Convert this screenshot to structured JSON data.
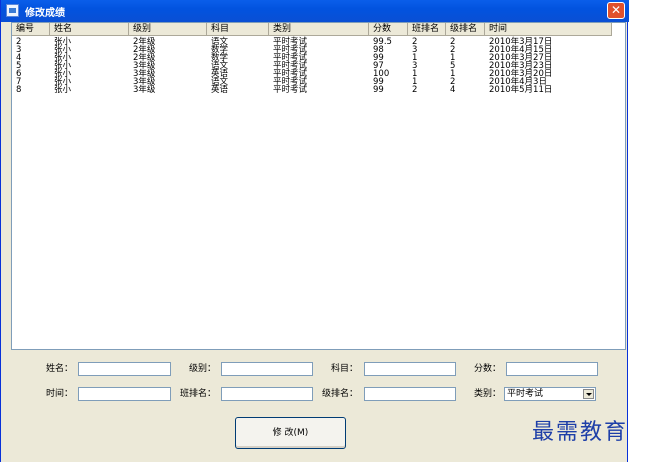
{
  "window": {
    "title": "修改成绩",
    "close_label": "✕"
  },
  "table": {
    "columns": [
      "编号",
      "姓名",
      "级别",
      "科目",
      "类别",
      "分数",
      "班排名",
      "级排名",
      "时间"
    ],
    "rows": [
      [
        "2",
        "张小",
        "2年级",
        "语文",
        "平时考试",
        "99.5",
        "2",
        "2",
        "2010年3月17日"
      ],
      [
        "3",
        "张小",
        "2年级",
        "数学",
        "平时考试",
        "98",
        "3",
        "2",
        "2010年4月15日"
      ],
      [
        "4",
        "张小",
        "2年级",
        "数学",
        "平时考试",
        "99",
        "1",
        "1",
        "2010年3月27日"
      ],
      [
        "5",
        "张小",
        "3年级",
        "语文",
        "平时考试",
        "97",
        "3",
        "5",
        "2010年3月23日"
      ],
      [
        "6",
        "张小",
        "3年级",
        "英语",
        "平时考试",
        "100",
        "1",
        "1",
        "2010年3月20日"
      ],
      [
        "7",
        "张小",
        "3年级",
        "语文",
        "平时考试",
        "99",
        "1",
        "2",
        "2010年4月3日"
      ],
      [
        "8",
        "张小",
        "3年级",
        "英语",
        "平时考试",
        "99",
        "2",
        "4",
        "2010年5月11日"
      ]
    ]
  },
  "form": {
    "name_label": "姓名：",
    "grade_label": "级别：",
    "subject_label": "科目：",
    "score_label": "分数：",
    "time_label": "时间：",
    "class_rank_label": "班排名：",
    "grade_rank_label": "级排名：",
    "category_label": "类别：",
    "category_value": "平时考试",
    "name_value": "",
    "grade_value": "",
    "subject_value": "",
    "score_value": "",
    "time_value": "",
    "class_rank_value": "",
    "grade_rank_value": ""
  },
  "buttons": {
    "modify_label": "修 改(M)"
  },
  "watermark": {
    "text": "最需教育"
  }
}
